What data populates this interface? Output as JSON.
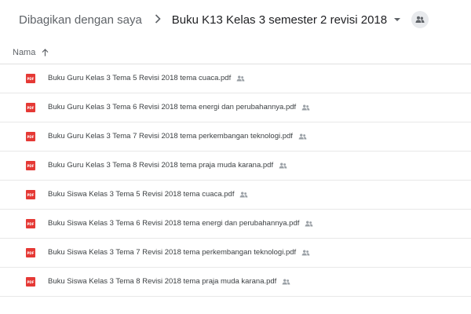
{
  "breadcrumb": {
    "root": "Dibagikan dengan saya",
    "separator": ">",
    "current": "Buku K13 Kelas 3 semester 2 revisi 2018"
  },
  "list_header": {
    "name_label": "Nama",
    "sort_icon": "arrow-up-icon"
  },
  "file_type_badge": "PDF",
  "files": [
    {
      "name": "Buku Guru Kelas 3 Tema 5 Revisi 2018 tema cuaca.pdf",
      "shared": true
    },
    {
      "name": "Buku Guru Kelas 3 Tema 6 Revisi 2018 tema energi dan perubahannya.pdf",
      "shared": true
    },
    {
      "name": "Buku Guru Kelas 3 Tema 7 Revisi 2018 tema perkembangan teknologi.pdf",
      "shared": true
    },
    {
      "name": "Buku Guru Kelas 3 Tema 8 Revisi 2018 tema praja muda karana.pdf",
      "shared": true
    },
    {
      "name": "Buku Siswa Kelas 3 Tema 5 Revisi 2018 tema cuaca.pdf",
      "shared": true
    },
    {
      "name": "Buku Siswa Kelas 3 Tema 6 Revisi 2018 tema energi dan perubahannya.pdf",
      "shared": true
    },
    {
      "name": "Buku Siswa Kelas 3 Tema 7 Revisi 2018 tema perkembangan teknologi.pdf",
      "shared": true
    },
    {
      "name": "Buku Siswa Kelas 3 Tema 8 Revisi 2018 tema praja muda karana.pdf",
      "shared": true
    }
  ],
  "colors": {
    "pdf_red": "#e53935",
    "text_primary": "#202124",
    "text_secondary": "#5f6368",
    "divider": "#e8e8e8"
  }
}
